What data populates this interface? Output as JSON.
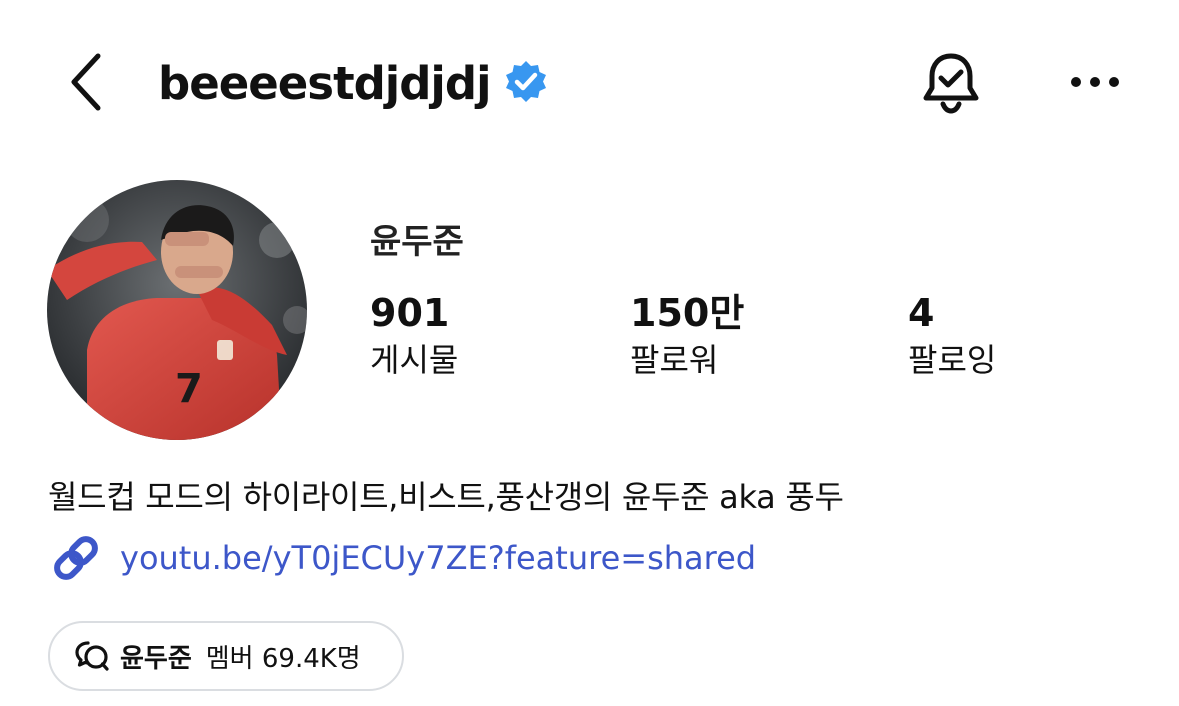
{
  "header": {
    "back_icon": "chevron-left-icon",
    "username": "beeeestdjdjdj",
    "verified_icon": "verified-badge-icon",
    "verified_color": "#3897f0",
    "bell_icon": "bell-check-icon",
    "more_icon": "more-horizontal-icon"
  },
  "profile": {
    "display_name": "윤두준",
    "stats": [
      {
        "value": "901",
        "label": "게시물"
      },
      {
        "value": "150만",
        "label": "팔로워"
      },
      {
        "value": "4",
        "label": "팔로잉"
      }
    ],
    "bio": "월드컵 모드의 하이라이트,비스트,풍산갱의 윤두준 aka 풍두",
    "link": {
      "icon": "link-icon",
      "text": "youtu.be/yT0jECUy7ZE?feature=shared",
      "color": "#3d57c9"
    },
    "channel": {
      "icon": "broadcast-channel-icon",
      "name": "윤두준",
      "members": "멤버 69.4K명"
    }
  }
}
